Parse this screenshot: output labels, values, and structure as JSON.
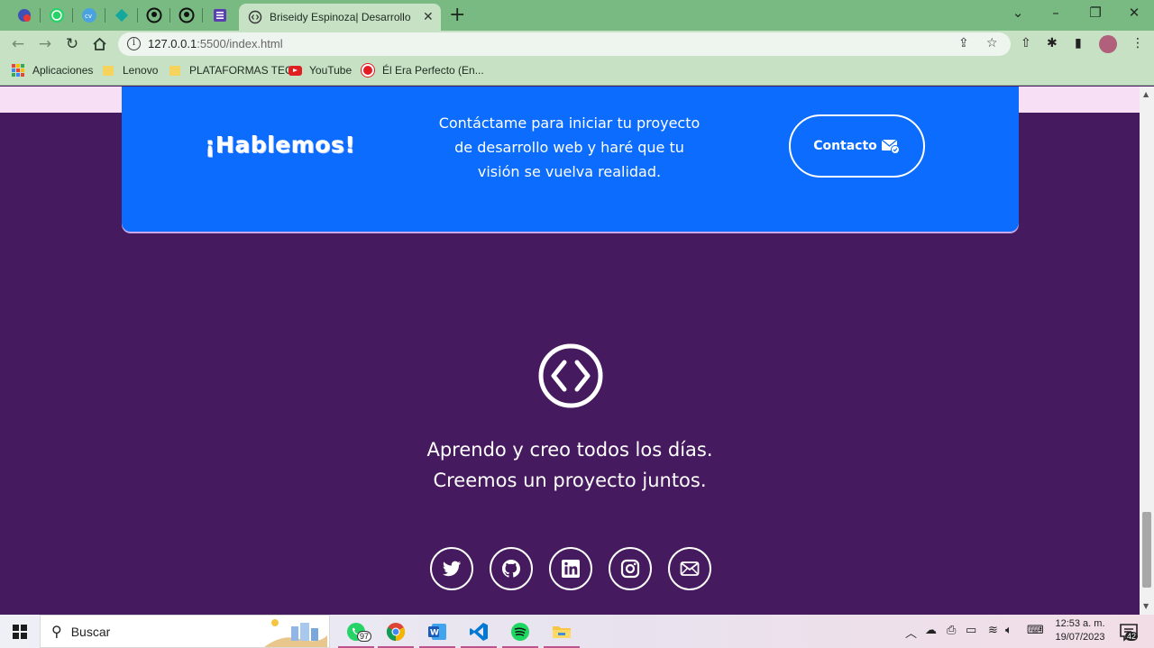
{
  "browser": {
    "active_tab_title": "Briseidy Espinoza| Desarrollo Web",
    "url_host": "127.0.0.1",
    "url_rest": ":5500/index.html",
    "new_tab_label": "+",
    "bookmarks": [
      {
        "label": "Aplicaciones",
        "icon": "apps-grid-icon"
      },
      {
        "label": "Lenovo",
        "icon": "folder-icon"
      },
      {
        "label": "PLATAFORMAS TEC",
        "icon": "folder-icon"
      },
      {
        "label": "YouTube",
        "icon": "youtube-icon"
      },
      {
        "label": "Él Era Perfecto (En...",
        "icon": "site-icon"
      }
    ]
  },
  "page": {
    "cta": {
      "heading": "¡Hablemos!",
      "text": "Contáctame para iniciar tu proyecto de desarrollo web y haré que tu visión se vuelva realidad.",
      "button_label": "Contacto"
    },
    "tagline_line1": "Aprendo y creo todos los días.",
    "tagline_line2": "Creemos un proyecto juntos.",
    "socials": [
      "twitter-icon",
      "github-icon",
      "linkedin-icon",
      "instagram-icon",
      "email-icon"
    ],
    "colors": {
      "background": "#461a5e",
      "cta": "#0c6cfd",
      "strip": "#f7dff6"
    }
  },
  "taskbar": {
    "search_placeholder": "Buscar",
    "whatsapp_badge": "97",
    "time": "12:53 a. m.",
    "date": "19/07/2023",
    "notifications": "42"
  }
}
